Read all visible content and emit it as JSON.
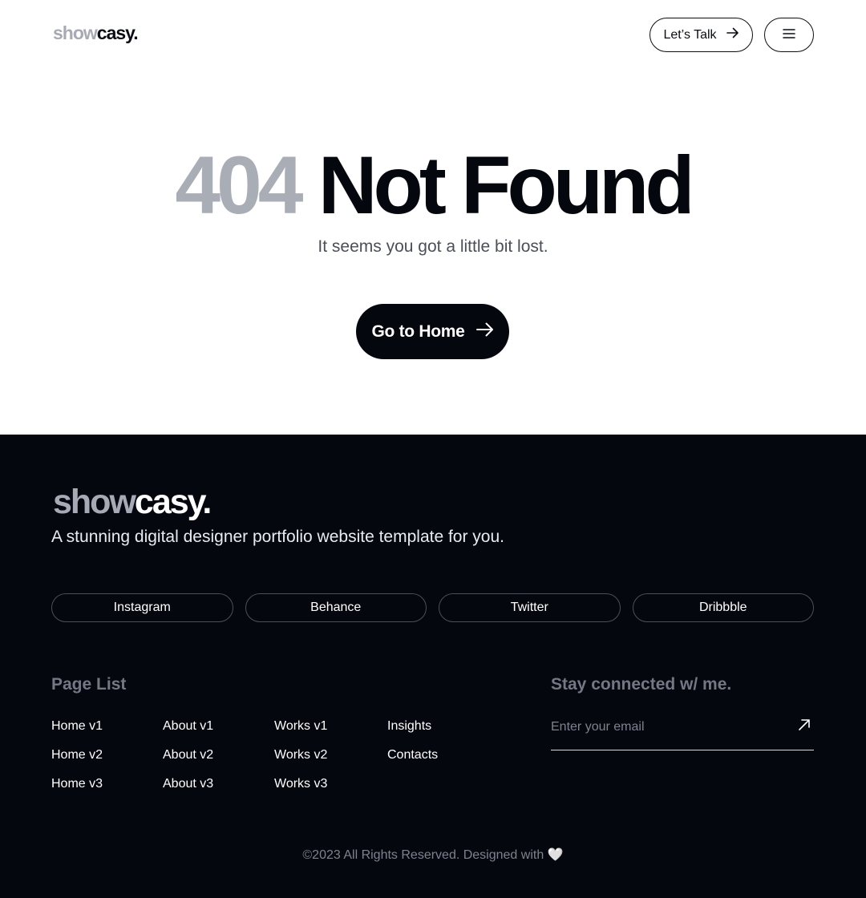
{
  "header": {
    "logo_light": "show",
    "logo_dark": "casy.",
    "talk_label": "Let’s Talk",
    "menu_icon": "hamburger-icon"
  },
  "hero": {
    "code": "404",
    "title": "Not Found",
    "subtitle": "It seems you got a little bit lost.",
    "home_label": "Go to Home"
  },
  "footer": {
    "logo_light": "show",
    "logo_dark": "casy.",
    "tagline": "A stunning digital designer portfolio website template for you.",
    "socials": [
      "Instagram",
      "Behance",
      "Twitter",
      "Dribbble"
    ],
    "page_list_title": "Page List",
    "pages": [
      [
        "Home v1",
        "Home v2",
        "Home v3"
      ],
      [
        "About v1",
        "About v2",
        "About v3"
      ],
      [
        "Works v1",
        "Works v2",
        "Works v3"
      ],
      [
        "Insights",
        "Contacts"
      ]
    ],
    "stay_title": "Stay connected w/ me.",
    "email_placeholder": "Enter your email",
    "copyright": "©2023 All Rights Reserved. Designed with",
    "heart": "🤍"
  },
  "colors": {
    "dark": "#05070e",
    "gray_logo": "#a6aab4",
    "muted": "#737884"
  }
}
